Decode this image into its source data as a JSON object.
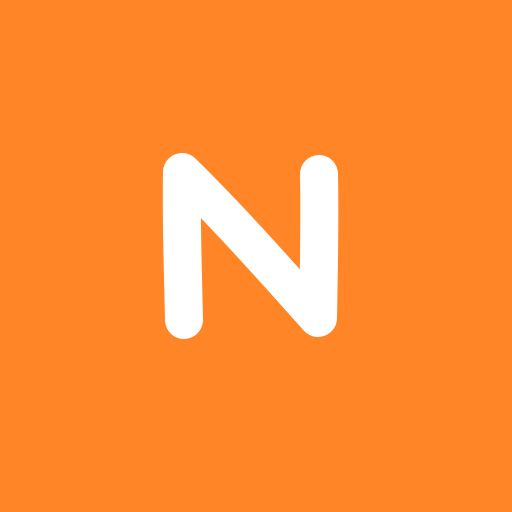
{
  "icon": {
    "letter": "N",
    "background_color": "#FF8526",
    "letter_color": "#FFFFFF",
    "icon_name": "n-letter-logo-icon"
  }
}
